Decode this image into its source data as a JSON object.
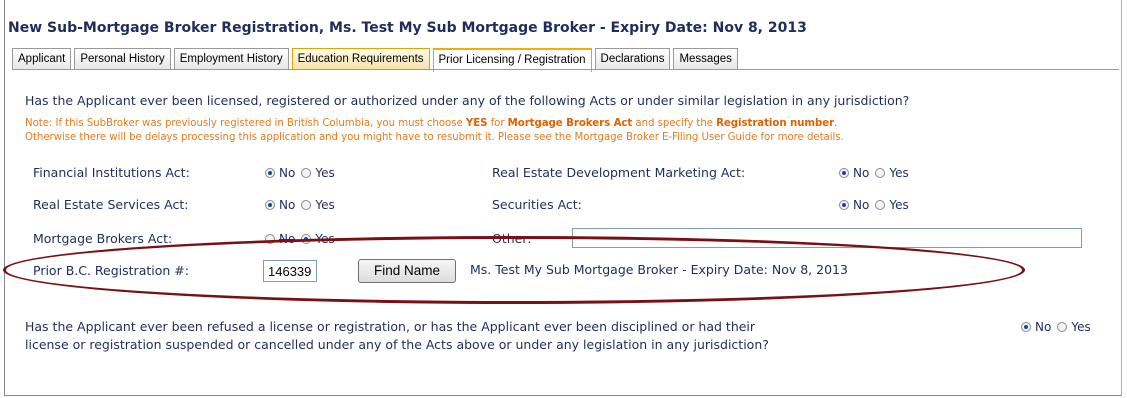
{
  "title": "New Sub-Mortgage Broker Registration, Ms. Test My Sub Mortgage Broker - Expiry Date: Nov 8, 2013",
  "tabs": [
    {
      "label": "Applicant"
    },
    {
      "label": "Personal History"
    },
    {
      "label": "Employment History"
    },
    {
      "label": "Education Requirements"
    },
    {
      "label": "Prior Licensing / Registration"
    },
    {
      "label": "Declarations"
    },
    {
      "label": "Messages"
    }
  ],
  "active_tab": "Prior Licensing / Registration",
  "question": "Has the Applicant ever been licensed, registered or authorized under any of the following Acts or under similar legislation in any jurisdiction?",
  "note": {
    "p1": "Note: If this SubBroker was previously registered in British Columbia, you must choose ",
    "b1": "YES",
    "p2": " for ",
    "b2": "Mortgage Brokers Act",
    "p3": " and specify the ",
    "b3": "Registration number",
    "p4": ".",
    "line2": "Otherwise there will be delays processing this application and you might have to resubmit it. Please see the Mortgage Broker E-Filing User Guide for more details."
  },
  "acts": {
    "financial": {
      "label": "Financial Institutions Act:",
      "selected": "No"
    },
    "real_estate_dev": {
      "label": "Real Estate Development Marketing Act:",
      "selected": "No"
    },
    "real_estate_services": {
      "label": "Real Estate Services Act:",
      "selected": "No"
    },
    "securities": {
      "label": "Securities Act:",
      "selected": "No"
    },
    "mortgage_brokers": {
      "label": "Mortgage Brokers Act:",
      "selected": "Yes"
    },
    "other": {
      "label": "Other:",
      "value": ""
    }
  },
  "options": {
    "no": "No",
    "yes": "Yes"
  },
  "prior_reg": {
    "label": "Prior B.C. Registration #:",
    "value": "146339",
    "button": "Find Name",
    "result": "Ms. Test My Sub Mortgage Broker - Expiry Date: Nov 8, 2013"
  },
  "refused": {
    "line1": "Has the Applicant ever been refused a license or registration, or has the Applicant ever been disciplined or had their",
    "line2": "license or registration suspended or cancelled under any of the Acts above or under any legislation in any jurisdiction?",
    "selected": "No"
  },
  "colors": {
    "label_text": "#1f2d5c",
    "note_text": "#ea7a1c",
    "highlight_ellipse": "#7a1016",
    "tab_accent": "#f0b000"
  }
}
